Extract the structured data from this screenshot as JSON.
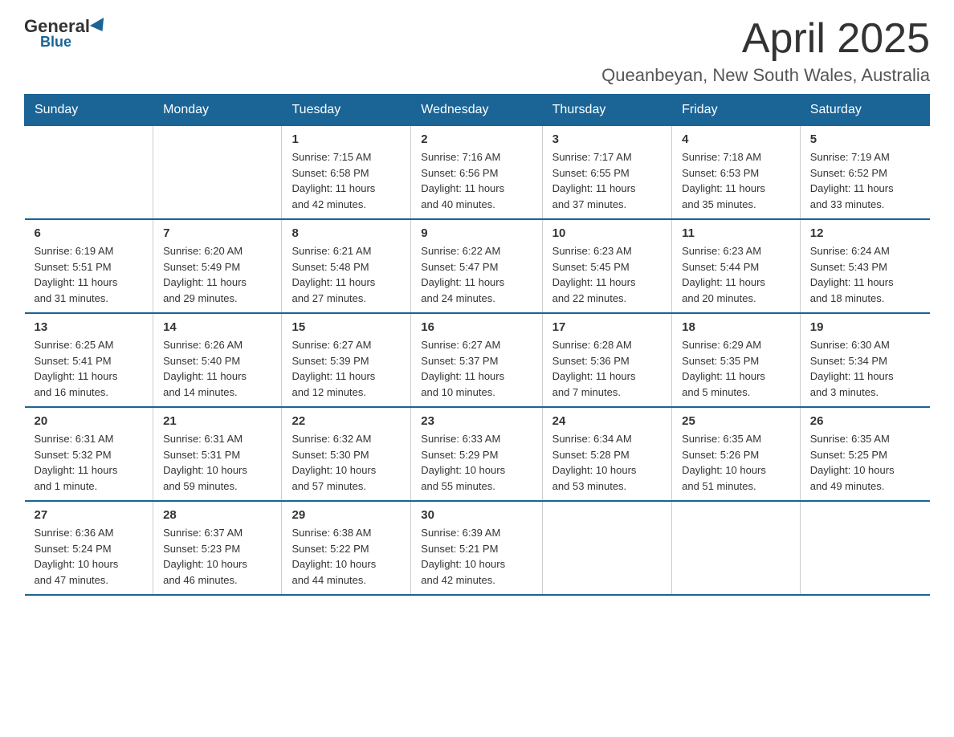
{
  "logo": {
    "general": "General",
    "blue": "Blue"
  },
  "header": {
    "month": "April 2025",
    "location": "Queanbeyan, New South Wales, Australia"
  },
  "days_of_week": [
    "Sunday",
    "Monday",
    "Tuesday",
    "Wednesday",
    "Thursday",
    "Friday",
    "Saturday"
  ],
  "weeks": [
    [
      {
        "day": "",
        "info": ""
      },
      {
        "day": "",
        "info": ""
      },
      {
        "day": "1",
        "info": "Sunrise: 7:15 AM\nSunset: 6:58 PM\nDaylight: 11 hours\nand 42 minutes."
      },
      {
        "day": "2",
        "info": "Sunrise: 7:16 AM\nSunset: 6:56 PM\nDaylight: 11 hours\nand 40 minutes."
      },
      {
        "day": "3",
        "info": "Sunrise: 7:17 AM\nSunset: 6:55 PM\nDaylight: 11 hours\nand 37 minutes."
      },
      {
        "day": "4",
        "info": "Sunrise: 7:18 AM\nSunset: 6:53 PM\nDaylight: 11 hours\nand 35 minutes."
      },
      {
        "day": "5",
        "info": "Sunrise: 7:19 AM\nSunset: 6:52 PM\nDaylight: 11 hours\nand 33 minutes."
      }
    ],
    [
      {
        "day": "6",
        "info": "Sunrise: 6:19 AM\nSunset: 5:51 PM\nDaylight: 11 hours\nand 31 minutes."
      },
      {
        "day": "7",
        "info": "Sunrise: 6:20 AM\nSunset: 5:49 PM\nDaylight: 11 hours\nand 29 minutes."
      },
      {
        "day": "8",
        "info": "Sunrise: 6:21 AM\nSunset: 5:48 PM\nDaylight: 11 hours\nand 27 minutes."
      },
      {
        "day": "9",
        "info": "Sunrise: 6:22 AM\nSunset: 5:47 PM\nDaylight: 11 hours\nand 24 minutes."
      },
      {
        "day": "10",
        "info": "Sunrise: 6:23 AM\nSunset: 5:45 PM\nDaylight: 11 hours\nand 22 minutes."
      },
      {
        "day": "11",
        "info": "Sunrise: 6:23 AM\nSunset: 5:44 PM\nDaylight: 11 hours\nand 20 minutes."
      },
      {
        "day": "12",
        "info": "Sunrise: 6:24 AM\nSunset: 5:43 PM\nDaylight: 11 hours\nand 18 minutes."
      }
    ],
    [
      {
        "day": "13",
        "info": "Sunrise: 6:25 AM\nSunset: 5:41 PM\nDaylight: 11 hours\nand 16 minutes."
      },
      {
        "day": "14",
        "info": "Sunrise: 6:26 AM\nSunset: 5:40 PM\nDaylight: 11 hours\nand 14 minutes."
      },
      {
        "day": "15",
        "info": "Sunrise: 6:27 AM\nSunset: 5:39 PM\nDaylight: 11 hours\nand 12 minutes."
      },
      {
        "day": "16",
        "info": "Sunrise: 6:27 AM\nSunset: 5:37 PM\nDaylight: 11 hours\nand 10 minutes."
      },
      {
        "day": "17",
        "info": "Sunrise: 6:28 AM\nSunset: 5:36 PM\nDaylight: 11 hours\nand 7 minutes."
      },
      {
        "day": "18",
        "info": "Sunrise: 6:29 AM\nSunset: 5:35 PM\nDaylight: 11 hours\nand 5 minutes."
      },
      {
        "day": "19",
        "info": "Sunrise: 6:30 AM\nSunset: 5:34 PM\nDaylight: 11 hours\nand 3 minutes."
      }
    ],
    [
      {
        "day": "20",
        "info": "Sunrise: 6:31 AM\nSunset: 5:32 PM\nDaylight: 11 hours\nand 1 minute."
      },
      {
        "day": "21",
        "info": "Sunrise: 6:31 AM\nSunset: 5:31 PM\nDaylight: 10 hours\nand 59 minutes."
      },
      {
        "day": "22",
        "info": "Sunrise: 6:32 AM\nSunset: 5:30 PM\nDaylight: 10 hours\nand 57 minutes."
      },
      {
        "day": "23",
        "info": "Sunrise: 6:33 AM\nSunset: 5:29 PM\nDaylight: 10 hours\nand 55 minutes."
      },
      {
        "day": "24",
        "info": "Sunrise: 6:34 AM\nSunset: 5:28 PM\nDaylight: 10 hours\nand 53 minutes."
      },
      {
        "day": "25",
        "info": "Sunrise: 6:35 AM\nSunset: 5:26 PM\nDaylight: 10 hours\nand 51 minutes."
      },
      {
        "day": "26",
        "info": "Sunrise: 6:35 AM\nSunset: 5:25 PM\nDaylight: 10 hours\nand 49 minutes."
      }
    ],
    [
      {
        "day": "27",
        "info": "Sunrise: 6:36 AM\nSunset: 5:24 PM\nDaylight: 10 hours\nand 47 minutes."
      },
      {
        "day": "28",
        "info": "Sunrise: 6:37 AM\nSunset: 5:23 PM\nDaylight: 10 hours\nand 46 minutes."
      },
      {
        "day": "29",
        "info": "Sunrise: 6:38 AM\nSunset: 5:22 PM\nDaylight: 10 hours\nand 44 minutes."
      },
      {
        "day": "30",
        "info": "Sunrise: 6:39 AM\nSunset: 5:21 PM\nDaylight: 10 hours\nand 42 minutes."
      },
      {
        "day": "",
        "info": ""
      },
      {
        "day": "",
        "info": ""
      },
      {
        "day": "",
        "info": ""
      }
    ]
  ]
}
